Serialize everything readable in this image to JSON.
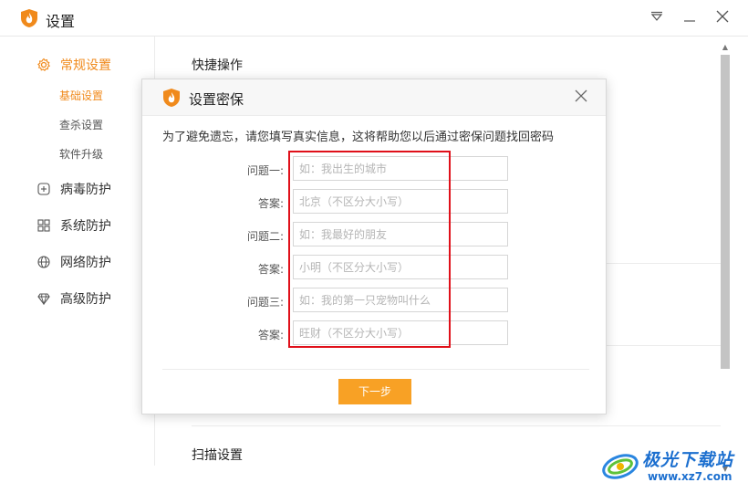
{
  "window": {
    "title": "设置",
    "menu_icon": "dropdown-triangle-icon",
    "min_icon": "minimize-icon",
    "close_icon": "close-icon"
  },
  "sidebar": {
    "items": [
      {
        "label": "常规设置",
        "icon": "gear-icon",
        "active": true
      },
      {
        "label": "病毒防护",
        "icon": "plus-square-icon",
        "active": false
      },
      {
        "label": "系统防护",
        "icon": "grid-icon",
        "active": false
      },
      {
        "label": "网络防护",
        "icon": "globe-icon",
        "active": false
      },
      {
        "label": "高级防护",
        "icon": "diamond-icon",
        "active": false
      }
    ],
    "sub_items": [
      {
        "label": "基础设置",
        "active": true
      },
      {
        "label": "查杀设置",
        "active": false
      },
      {
        "label": "软件升级",
        "active": false
      }
    ]
  },
  "content": {
    "section_quick": "快捷操作",
    "section_scan": "扫描设置"
  },
  "dialog": {
    "title": "设置密保",
    "description": "为了避免遗忘，请您填写真实信息，这将帮助您以后通过密保问题找回密码",
    "fields": [
      {
        "label": "问题一:",
        "placeholder": "如：我出生的城市",
        "value": ""
      },
      {
        "label": "答案:",
        "placeholder": "北京（不区分大小写）",
        "value": ""
      },
      {
        "label": "问题二:",
        "placeholder": "如：我最好的朋友",
        "value": ""
      },
      {
        "label": "答案:",
        "placeholder": "小明（不区分大小写）",
        "value": ""
      },
      {
        "label": "问题三:",
        "placeholder": "如：我的第一只宠物叫什么",
        "value": ""
      },
      {
        "label": "答案:",
        "placeholder": "旺财（不区分大小写）",
        "value": ""
      }
    ],
    "next_label": "下一步"
  },
  "watermark": {
    "name": "极光下载站",
    "url": "www.xz7.com"
  },
  "colors": {
    "accent": "#f08a1c",
    "button": "#f8a125",
    "highlight_box": "#e0101a"
  }
}
